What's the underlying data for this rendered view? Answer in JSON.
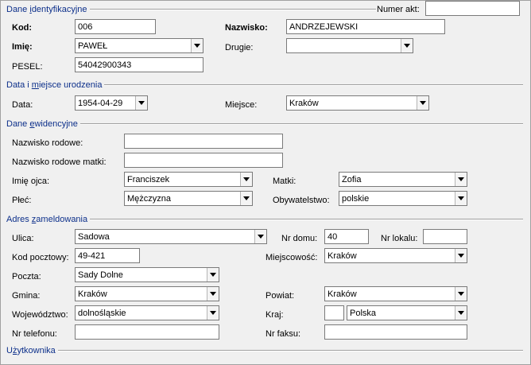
{
  "sections": {
    "identyfikacyjne": {
      "pre": "Dane ",
      "ul": "i",
      "post": "dentyfikacyjne"
    },
    "urodzenia": {
      "pre": "Data i ",
      "ul": "m",
      "post": "iejsce urodzenia"
    },
    "ewidencyjne": {
      "pre": "Dane ",
      "ul": "e",
      "post": "widencyjne"
    },
    "zameldowania": {
      "pre": "Adres ",
      "ul": "z",
      "post": "ameldowania"
    },
    "uzytkownika": {
      "pre": "U",
      "ul": "ż",
      "post": "ytkownika"
    }
  },
  "ident": {
    "numer_akt_label": "Numer akt:",
    "numer_akt_value": "",
    "kod_label": "Kod:",
    "kod_value": "006",
    "nazwisko_label": "Nazwisko:",
    "nazwisko_value": "ANDRZEJEWSKI",
    "imie_label": "Imię:",
    "imie_value": "PAWEŁ",
    "drugie_label": "Drugie:",
    "drugie_value": "",
    "pesel_label": "PESEL:",
    "pesel_value": "54042900343"
  },
  "birth": {
    "data_label": "Data:",
    "data_value": "1954-04-29",
    "miejsce_label": "Miejsce:",
    "miejsce_value": "Kraków"
  },
  "evid": {
    "nazwisko_rodowe_label": "Nazwisko rodowe:",
    "nazwisko_rodowe_value": "",
    "nazwisko_rodowe_matki_label": "Nazwisko rodowe matki:",
    "nazwisko_rodowe_matki_value": "",
    "imie_ojca_label": "Imię ojca:",
    "imie_ojca_value": "Franciszek",
    "matki_label": "Matki:",
    "matki_value": "Zofia",
    "plec_label": "Płeć:",
    "plec_value": "Mężczyzna",
    "obywatelstwo_label": "Obywatelstwo:",
    "obywatelstwo_value": "polskie"
  },
  "addr": {
    "ulica_label": "Ulica:",
    "ulica_value": "Sadowa",
    "nr_domu_label": "Nr domu:",
    "nr_domu_value": "40",
    "nr_lokalu_label": "Nr lokalu:",
    "nr_lokalu_value": "",
    "kod_pocztowy_label": "Kod pocztowy:",
    "kod_pocztowy_value": "49-421",
    "miejscowosc_label": "Miejscowość:",
    "miejscowosc_value": "Kraków",
    "poczta_label": "Poczta:",
    "poczta_value": "Sady Dolne",
    "gmina_label": "Gmina:",
    "gmina_value": "Kraków",
    "powiat_label": "Powiat:",
    "powiat_value": "Kraków",
    "wojewodztwo_label": "Województwo:",
    "wojewodztwo_value": "dolnośląskie",
    "kraj_label": "Kraj:",
    "kraj_code_value": "",
    "kraj_value": "Polska",
    "nr_telefonu_label": "Nr telefonu:",
    "nr_telefonu_value": "",
    "nr_faksu_label": "Nr faksu:",
    "nr_faksu_value": ""
  }
}
